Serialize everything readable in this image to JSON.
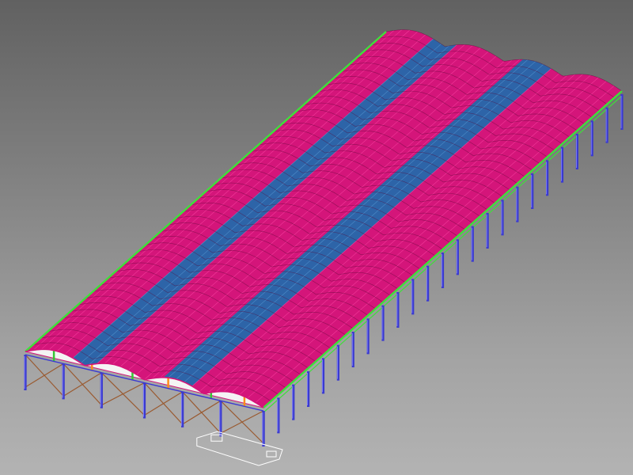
{
  "viewport": {
    "background_top": "#616161",
    "background_bottom": "#b3b3b3"
  },
  "model": {
    "frame_spans": 24,
    "roof_bands": [
      "pink",
      "blue",
      "pink",
      "blue",
      "pink"
    ],
    "colors": {
      "roof_pink": "#d4157a",
      "roof_pink_line": "#ff4aa8",
      "roof_blue": "#2d64a8",
      "roof_blue_line": "#5c9ed6",
      "eave_green": "#3ee03a",
      "column_blue": "#3a3ad0",
      "column_highlight": "#8a8aff",
      "bracing_brown": "#9a5a30",
      "gable_white": "#f4f4f4",
      "gable_green": "#35c735",
      "gable_orange": "#ff8c1a",
      "base_outline": "#ffffff"
    }
  }
}
